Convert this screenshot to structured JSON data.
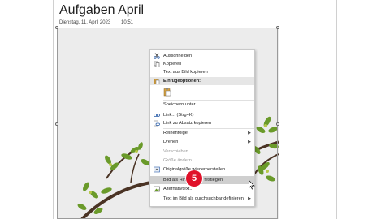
{
  "page": {
    "title": "Aufgaben April",
    "date": "Dienstag, 11. April 2023",
    "time": "10:51"
  },
  "context_menu": {
    "items": [
      {
        "label": "Ausschneiden",
        "icon": "scissors-icon"
      },
      {
        "label": "Kopieren",
        "icon": "copy-icon"
      },
      {
        "label": "Text aus Bild kopieren",
        "icon": ""
      },
      {
        "label": "Einfügeoptionen:",
        "icon": "paste-icon"
      },
      {
        "label": "Speichern unter...",
        "icon": ""
      },
      {
        "label": "Link... (Strg+K)",
        "icon": "link-icon"
      },
      {
        "label": "Link zu Absatz kopieren",
        "icon": "link-paragraph-icon"
      },
      {
        "label": "Reihenfolge",
        "icon": ""
      },
      {
        "label": "Drehen",
        "icon": ""
      },
      {
        "label": "Verschieben",
        "icon": ""
      },
      {
        "label": "Größe ändern",
        "icon": ""
      },
      {
        "label": "Originalgröße wiederherstellen",
        "icon": "restore-size-icon"
      },
      {
        "label": "Bild als Hintergrund festlegen",
        "icon": ""
      },
      {
        "label": "Alternativtext...",
        "icon": "alt-text-icon"
      },
      {
        "label": "Text im Bild als durchsuchbar definieren",
        "icon": ""
      }
    ]
  },
  "step_badge": "5",
  "colors": {
    "badge": "#e0122a",
    "menu_highlight": "#cfcfcf",
    "header_bg": "#e6e6e6"
  }
}
